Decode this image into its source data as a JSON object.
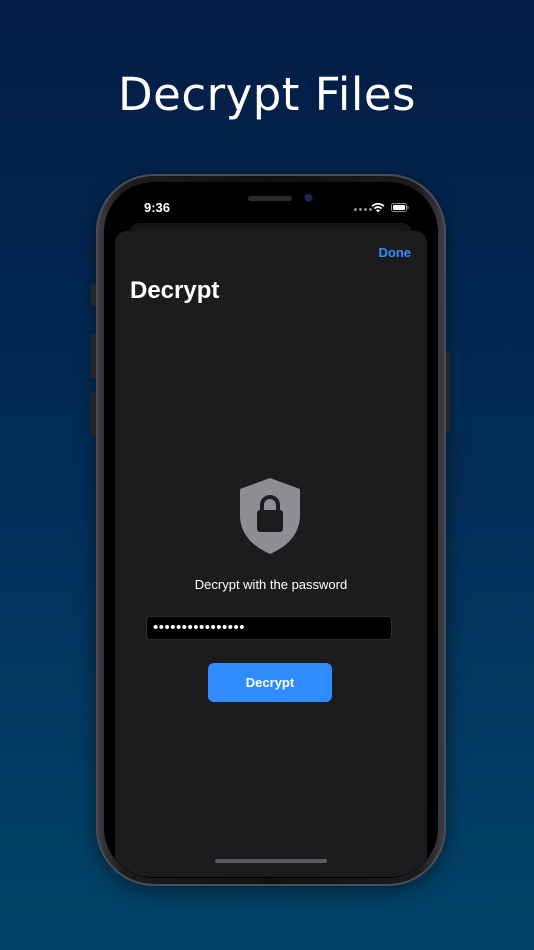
{
  "headline": "Decrypt Files",
  "status_bar": {
    "time": "9:36",
    "wifi_icon": "wifi-icon",
    "battery_icon": "battery-icon"
  },
  "sheet": {
    "done_label": "Done",
    "title": "Decrypt",
    "icon": "shield-lock-icon",
    "prompt": "Decrypt with the password",
    "password_value": "••••••••••••••••",
    "decrypt_label": "Decrypt"
  },
  "colors": {
    "accent": "#2f8cff",
    "sheet_background": "#1c1c1e",
    "background_top": "#021c44",
    "background_bottom": "#024568"
  }
}
